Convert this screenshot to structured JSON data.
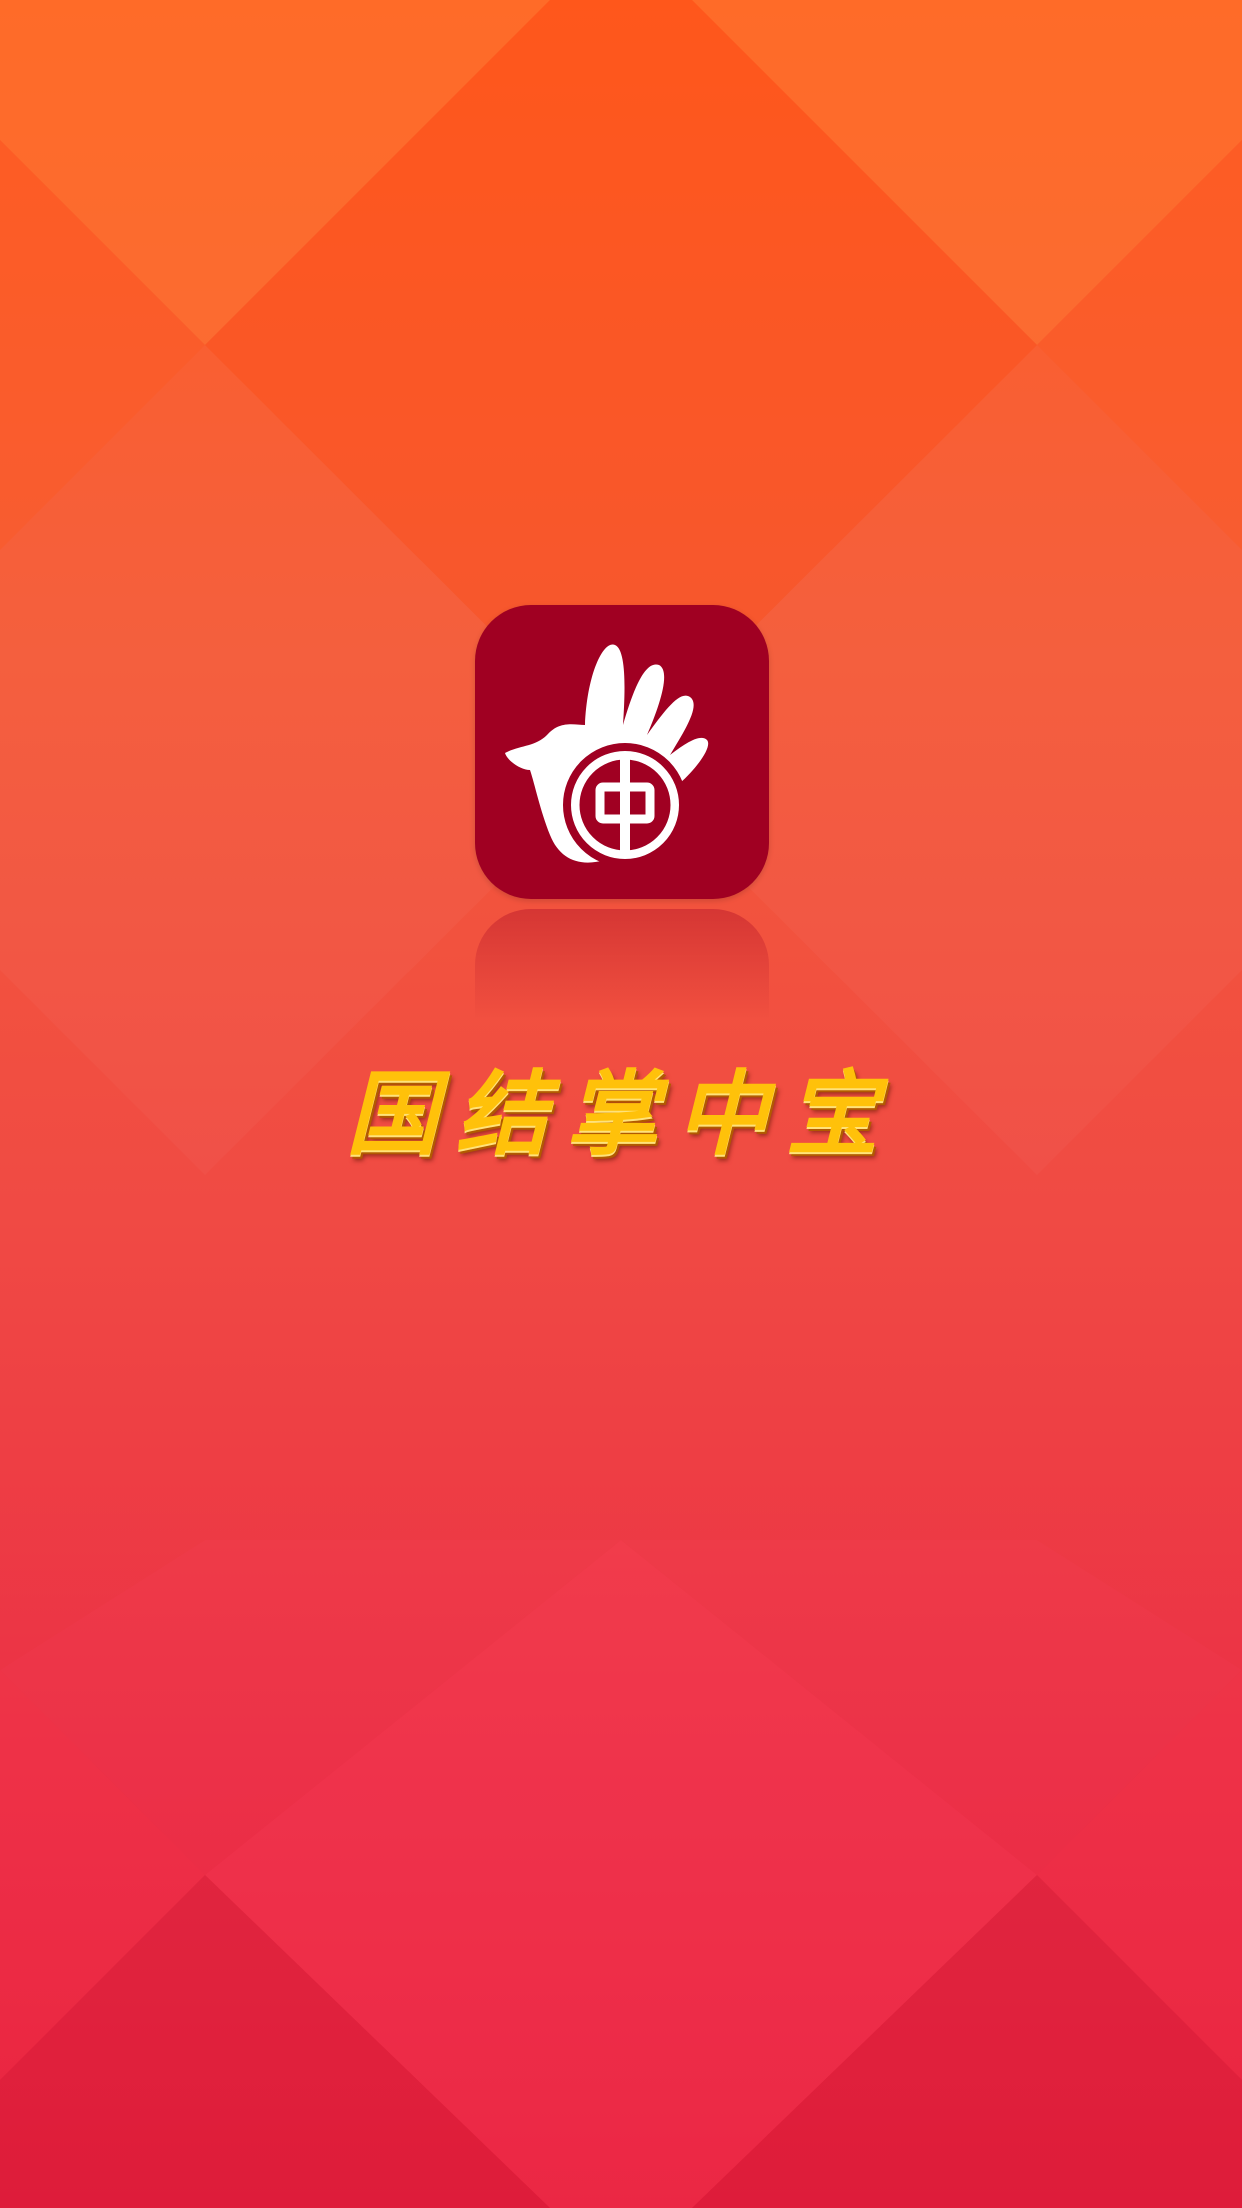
{
  "app": {
    "name": "国结掌中宝",
    "icon": "hand-dove-bank-logo-icon"
  },
  "colors": {
    "background_top": "#ff5a1e",
    "background_bottom": "#e61f3c",
    "icon_bg": "#a00022",
    "title_gold": "#ffc10a"
  }
}
